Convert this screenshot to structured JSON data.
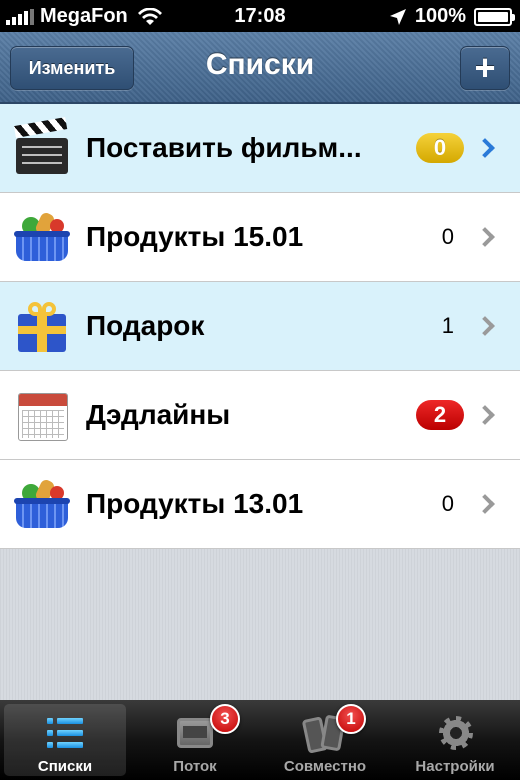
{
  "status_bar": {
    "carrier": "MegaFon",
    "time": "17:08",
    "battery": "100%"
  },
  "nav": {
    "title": "Списки",
    "edit_label": "Изменить",
    "add_label": "+"
  },
  "lists": [
    {
      "label": "Поставить фильм...",
      "count": "0",
      "icon": "clapperboard-icon",
      "badge": "yellow",
      "style": "highlight"
    },
    {
      "label": "Продукты 15.01",
      "count": "0",
      "icon": "basket-icon",
      "badge": "none",
      "style": "plain"
    },
    {
      "label": "Подарок",
      "count": "1",
      "icon": "gift-icon",
      "badge": "none",
      "style": "highlight"
    },
    {
      "label": "Дэдлайны",
      "count": "2",
      "icon": "calendar-icon",
      "badge": "red",
      "style": "plain"
    },
    {
      "label": "Продукты 13.01",
      "count": "0",
      "icon": "basket-icon",
      "badge": "none",
      "style": "plain"
    }
  ],
  "tabs": [
    {
      "label": "Списки",
      "icon": "list-icon",
      "badge": ""
    },
    {
      "label": "Поток",
      "icon": "inbox-icon",
      "badge": "3"
    },
    {
      "label": "Совместно",
      "icon": "phones-icon",
      "badge": "1"
    },
    {
      "label": "Настройки",
      "icon": "gear-icon",
      "badge": ""
    }
  ],
  "colors": {
    "nav_blue": "#4a6f97",
    "row_highlight": "#d9f2fb",
    "badge_yellow": "#e2b90c",
    "badge_red": "#d80000",
    "chevron_blue": "#2a7ad8"
  }
}
